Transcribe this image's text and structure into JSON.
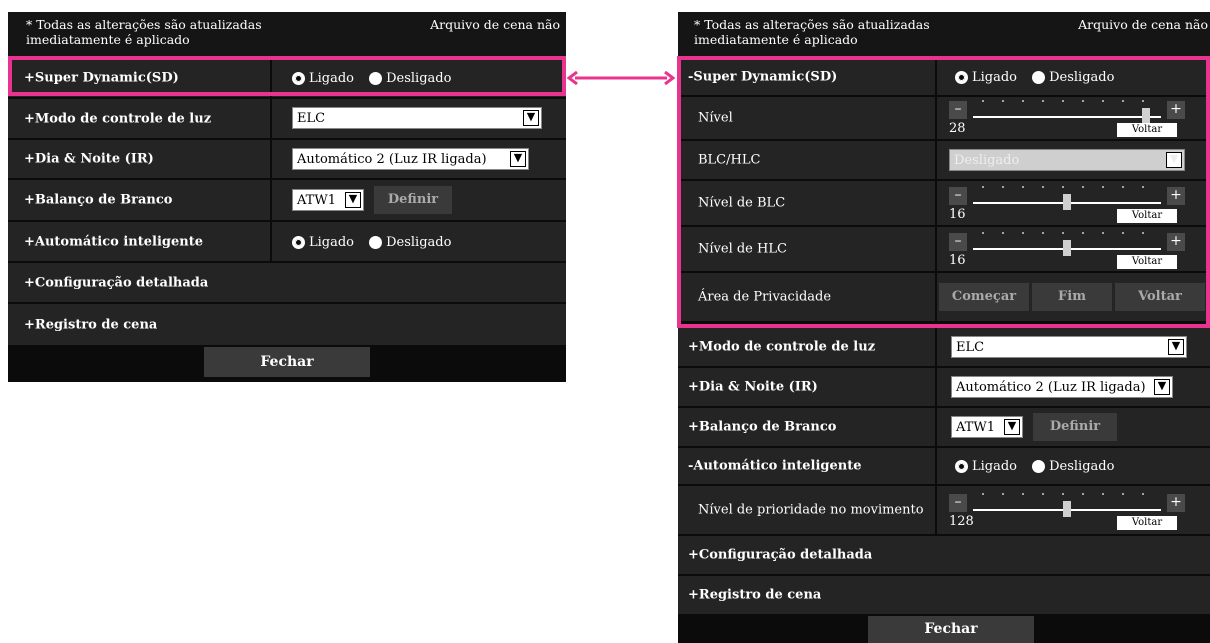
{
  "left": {
    "notice": "* Todas as alterações são atualizadas imediatamente é aplicado",
    "notice_right": "Arquivo de cena não",
    "sd_label": "+Super Dynamic(SD)",
    "on": "Ligado",
    "off": "Desligado",
    "light_mode_label": "+Modo de controle de luz",
    "light_mode_value": "ELC",
    "day_night_label": "+Dia & Noite (IR)",
    "day_night_value": "Automático 2 (Luz IR ligada)",
    "wb_label": "+Balanço de Branco",
    "wb_value": "ATW1",
    "define": "Definir",
    "smart_auto_label": "+Automático inteligente",
    "detail_label": "+Configuração detalhada",
    "scene_label": "+Registro de cena",
    "close": "Fechar"
  },
  "right": {
    "notice": "* Todas as alterações são atualizadas imediatamente é aplicado",
    "notice_right": "Arquivo de cena não",
    "sd_label": "-Super Dynamic(SD)",
    "on": "Ligado",
    "off": "Desligado",
    "level_label": "Nível",
    "level_value": "28",
    "reset": "Voltar",
    "blchlc_label": "BLC/HLC",
    "blchlc_value": "Desligado",
    "blc_label": "Nível de BLC",
    "blc_value": "16",
    "hlc_label": "Nível de HLC",
    "hlc_value": "16",
    "privacy_label": "Área de Privacidade",
    "start": "Começar",
    "end": "Fim",
    "back": "Voltar",
    "light_mode_label": "+Modo de controle de luz",
    "light_mode_value": "ELC",
    "day_night_label": "+Dia & Noite (IR)",
    "day_night_value": "Automático 2 (Luz IR ligada)",
    "wb_label": "+Balanço de Branco",
    "wb_value": "ATW1",
    "define": "Definir",
    "smart_auto_label": "-Automático inteligente",
    "motion_priority_label": "Nível de prioridade no movimento",
    "motion_priority_value": "128",
    "detail_label": "+Configuração detalhada",
    "scene_label": "+Registro de cena",
    "close": "Fechar"
  },
  "sliders": {
    "level": 0.92,
    "blc": 0.5,
    "hlc": 0.5,
    "motion": 0.5
  },
  "colors": {
    "highlight": "#e8348f",
    "panel_bg": "#0b0b0b",
    "row_bg": "#242424"
  }
}
